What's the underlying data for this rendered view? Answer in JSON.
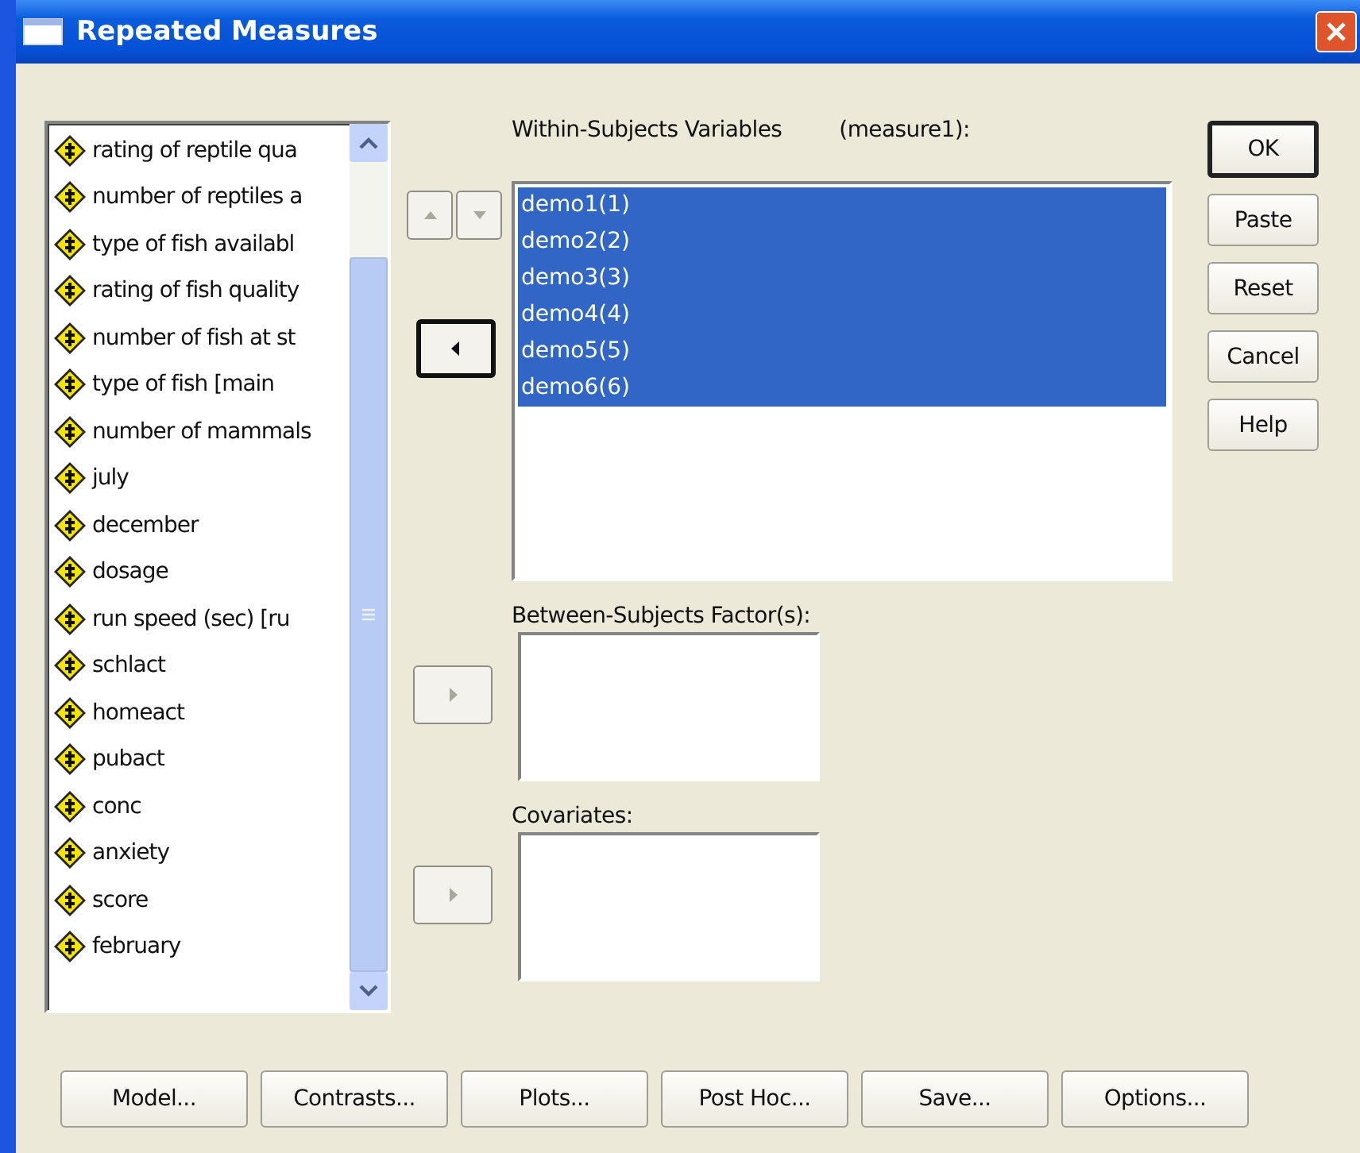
{
  "window": {
    "title": "Repeated Measures"
  },
  "variables": [
    {
      "label": "rating of reptile qua"
    },
    {
      "label": "number of reptiles a"
    },
    {
      "label": "type of fish availabl"
    },
    {
      "label": "rating of fish quality"
    },
    {
      "label": "number of fish at st"
    },
    {
      "label": "type of fish [main"
    },
    {
      "label": "number of mammals"
    },
    {
      "label": "july"
    },
    {
      "label": "december"
    },
    {
      "label": "dosage"
    },
    {
      "label": "run speed (sec) [ru"
    },
    {
      "label": "schlact"
    },
    {
      "label": "homeact"
    },
    {
      "label": "pubact"
    },
    {
      "label": "conc"
    },
    {
      "label": "anxiety"
    },
    {
      "label": "score"
    },
    {
      "label": "february"
    }
  ],
  "order_buttons": [
    {
      "kind": "up",
      "disabled": true
    },
    {
      "kind": "down",
      "disabled": true
    }
  ],
  "within": {
    "label": "Within-Subjects Variables",
    "measure": "(measure1):",
    "move_button": {
      "kind": "left",
      "disabled": false
    },
    "items": [
      {
        "label": "demo1(1)",
        "selected": true
      },
      {
        "label": "demo2(2)",
        "selected": true
      },
      {
        "label": "demo3(3)",
        "selected": true
      },
      {
        "label": "demo4(4)",
        "selected": true
      },
      {
        "label": "demo5(5)",
        "selected": true
      },
      {
        "label": "demo6(6)",
        "selected": true
      }
    ]
  },
  "between": {
    "label": "Between-Subjects Factor(s):",
    "move_button": {
      "kind": "right",
      "disabled": true
    }
  },
  "covariates": {
    "label": "Covariates:",
    "move_button": {
      "kind": "right",
      "disabled": true
    }
  },
  "side_buttons": [
    {
      "label": "OK",
      "default": true
    },
    {
      "label": "Paste",
      "default": false
    },
    {
      "label": "Reset",
      "default": false
    },
    {
      "label": "Cancel",
      "default": false
    },
    {
      "label": "Help",
      "default": false
    }
  ],
  "bottom_buttons": [
    {
      "label": "Model..."
    },
    {
      "label": "Contrasts..."
    },
    {
      "label": "Plots..."
    },
    {
      "label": "Post Hoc..."
    },
    {
      "label": "Save..."
    },
    {
      "label": "Options..."
    }
  ]
}
